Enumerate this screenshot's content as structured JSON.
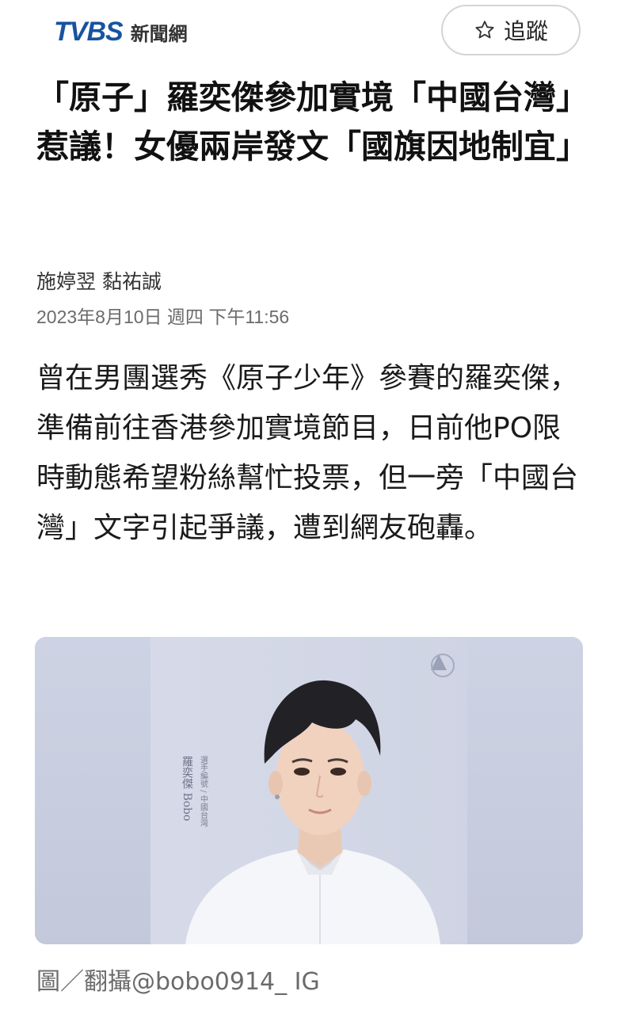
{
  "header": {
    "logo_mark": "TVBS",
    "logo_text": "新聞網",
    "follow_label": "追蹤",
    "follow_icon": "star-outline-icon"
  },
  "article": {
    "headline": "「原子」羅奕傑參加實境「中國台灣」惹議！女優兩岸發文「國旗因地制宜」",
    "authors": "施婷翌 黏祐誠",
    "datetime": "2023年8月10日 週四 下午11:56",
    "lede": "曾在男團選秀《原子少年》參賽的羅奕傑，準備前往香港參加實境節目，日前他PO限時動態希望粉絲幫忙投票，但一旁「中國台灣」文字引起爭議，遭到網友砲轟。",
    "photo": {
      "name_tag": "羅奕傑 Bobo",
      "side_note": "選手編號 / 中國台灣"
    },
    "caption": "圖／翻攝@bobo0914_ IG"
  },
  "colors": {
    "brand_blue": "#17539f",
    "photo_bg": "#c9cfe0",
    "text_dark": "#111111",
    "text_muted": "#6b6b6b"
  }
}
